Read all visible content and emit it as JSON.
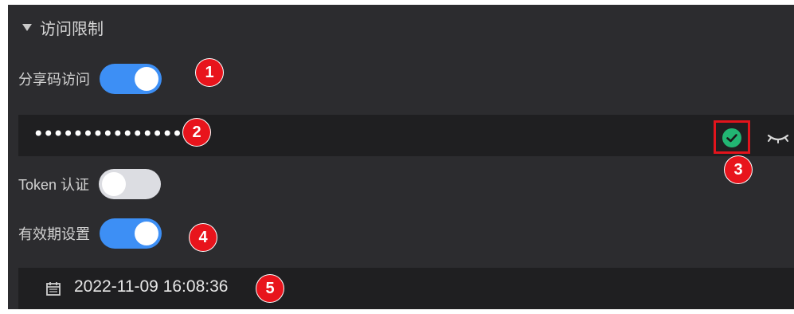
{
  "section": {
    "title": "访问限制"
  },
  "share_code": {
    "label": "分享码访问",
    "enabled": true,
    "badge": "1"
  },
  "password": {
    "value": "••••••••••••••••",
    "badge": "2",
    "verify_badge": "3"
  },
  "token": {
    "label": "Token 认证",
    "enabled": false
  },
  "validity": {
    "label": "有效期设置",
    "enabled": true,
    "badge": "4"
  },
  "expiry": {
    "value": "2022-11-09 16:08:36",
    "badge": "5"
  },
  "colors": {
    "panel": "#2c2c2f",
    "field": "#1f1f21",
    "switch_on": "#3d8ff5",
    "switch_off": "#dcdde2",
    "badge": "#e8141c",
    "verified": "#22b573"
  },
  "icons": [
    "caret-down-icon",
    "check-circle-icon",
    "eye-closed-icon",
    "calendar-icon"
  ]
}
